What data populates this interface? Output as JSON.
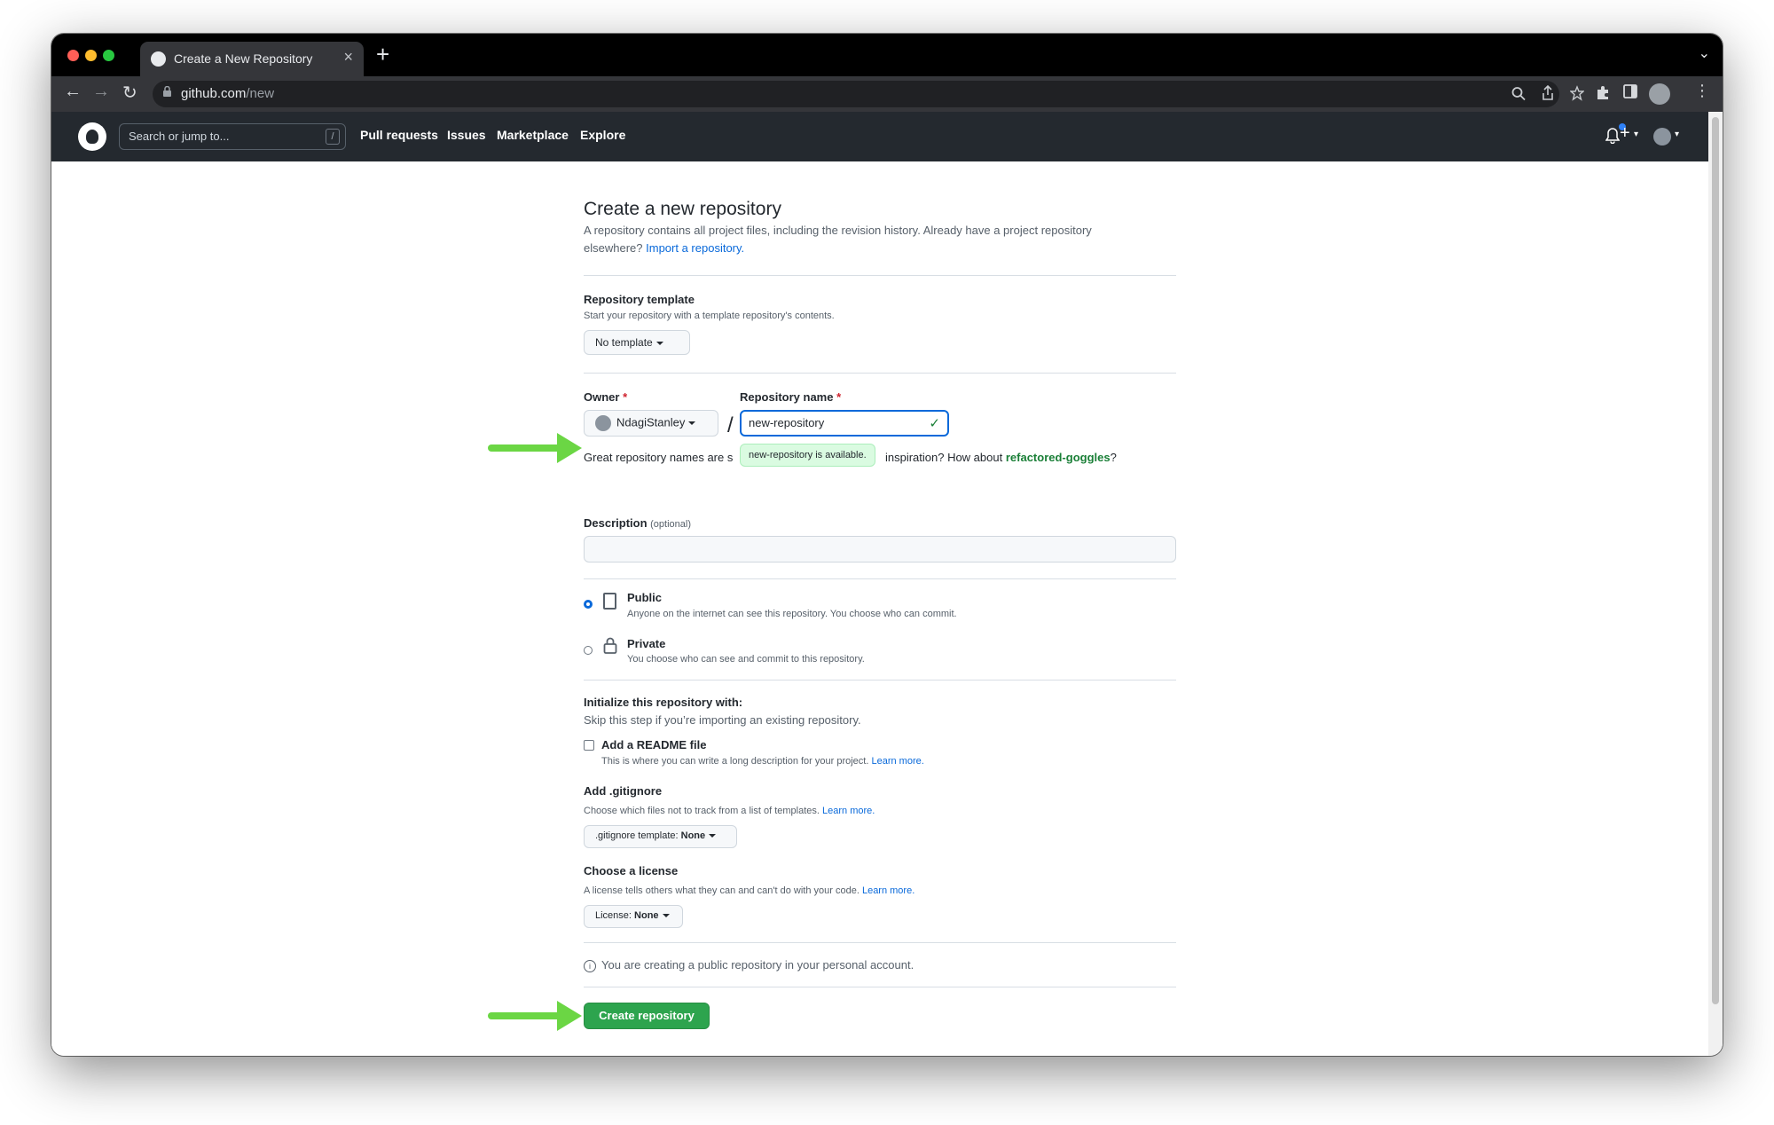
{
  "browser": {
    "tab_title": "Create a New Repository",
    "close_glyph": "×",
    "newtab_glyph": "+",
    "menu_glyph": "⌄",
    "url_host": "github.com",
    "url_path": "/new",
    "back_glyph": "←",
    "forward_glyph": "→",
    "reload_glyph": "↻"
  },
  "header": {
    "search_placeholder": "Search or jump to...",
    "search_shortcut": "/",
    "nav": [
      "Pull requests",
      "Issues",
      "Marketplace",
      "Explore"
    ],
    "bell_glyph": "🔔",
    "plus_glyph": "+",
    "caret_glyph": "▾"
  },
  "page": {
    "title": "Create a new repository",
    "lead_text": "A repository contains all project files, including the revision history. Already have a project repository elsewhere?",
    "import_link": "Import a repository.",
    "template": {
      "label": "Repository template",
      "note": "Start your repository with a template repository's contents.",
      "button": "No template"
    },
    "owner": {
      "label": "Owner",
      "required_mark": "*",
      "value": "NdagiStanley"
    },
    "repo": {
      "label": "Repository name",
      "required_mark": "*",
      "value": "new-repository",
      "check_glyph": "✓",
      "separator": "/"
    },
    "hint": {
      "prefix": "Great repository names are s",
      "middle": " inspiration? How about ",
      "suggestion": "refactored-goggles",
      "suffix": "?",
      "tooltip": "new-repository is available."
    },
    "description": {
      "label": "Description",
      "optional": "(optional)"
    },
    "visibility": {
      "public_title": "Public",
      "public_desc": "Anyone on the internet can see this repository. You choose who can commit.",
      "private_title": "Private",
      "private_desc": "You choose who can see and commit to this repository."
    },
    "init": {
      "title": "Initialize this repository with:",
      "subtitle": "Skip this step if you’re importing an existing repository.",
      "readme_label": "Add a README file",
      "readme_desc": "This is where you can write a long description for your project.",
      "learn_more": "Learn more."
    },
    "gitignore": {
      "label": "Add .gitignore",
      "note": "Choose which files not to track from a list of templates.",
      "learn_more": "Learn more.",
      "button_prefix": ".gitignore template: ",
      "button_value": "None"
    },
    "license": {
      "label": "Choose a license",
      "note": "A license tells others what they can and can't do with your code.",
      "learn_more": "Learn more.",
      "button_prefix": "License: ",
      "button_value": "None"
    },
    "public_notice": "You are creating a public repository in your personal account.",
    "info_glyph": "i",
    "create_button": "Create repository"
  },
  "colors": {
    "accent_blue": "#0969da",
    "primary_green": "#2da44e",
    "annotation_arrow": "#6bd644",
    "header_bg": "#24292f"
  }
}
